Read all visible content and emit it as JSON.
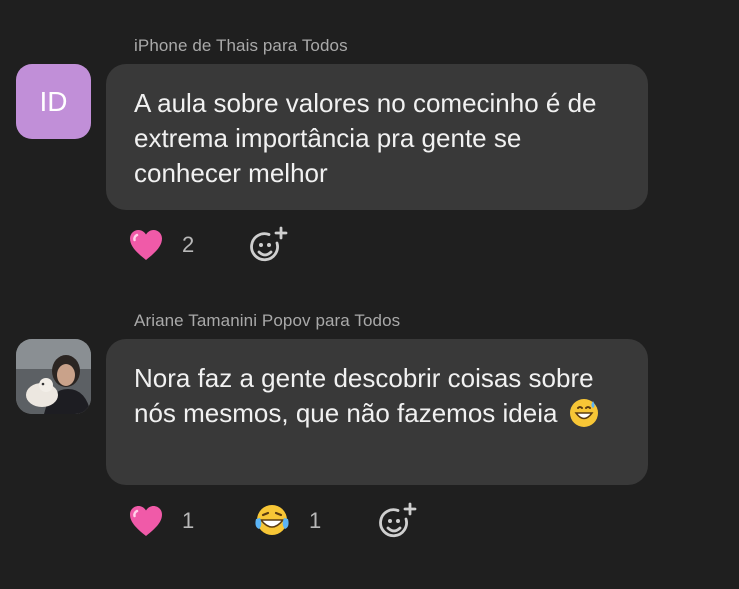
{
  "messages": [
    {
      "sender": "iPhone de Thais para Todos",
      "avatar_initials": "ID",
      "text": "A aula sobre valores no comecinho é de extrema importância pra gente se conhecer melhor",
      "reactions": [
        {
          "emoji": "pink-heart",
          "count": "2"
        }
      ]
    },
    {
      "sender": "Ariane Tamanini Popov para Todos",
      "avatar": "profile-photo",
      "text": "Nora faz a gente descobrir coisas sobre nós mesmos, que não fazemos ideia",
      "text_emoji": "grinning-sweat",
      "reactions": [
        {
          "emoji": "pink-heart",
          "count": "1"
        },
        {
          "emoji": "tears-of-joy",
          "count": "1"
        }
      ]
    }
  ],
  "icons": {
    "add_reaction": "add-reaction-icon"
  },
  "colors": {
    "background": "#1f1f1f",
    "bubble": "#393939",
    "avatar_initials_bg": "#c18fd8",
    "sender_text": "#a9a9a9"
  }
}
